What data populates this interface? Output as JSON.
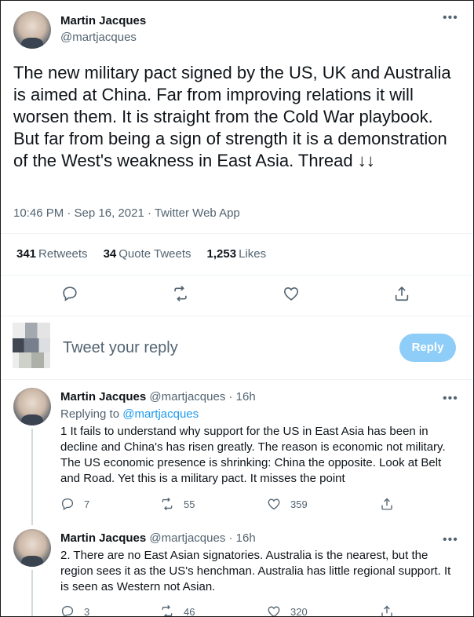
{
  "tweet": {
    "author_name": "Martin Jacques",
    "author_handle": "@martjacques",
    "text": "The new military pact signed by the US, UK and Australia is aimed at China. Far from improving relations it will worsen them. It is straight from the Cold War playbook. But far from being a sign of strength it is a demonstration of the West's weakness in East Asia. Thread ↓↓",
    "meta": "10:46 PM · Sep 16, 2021 · Twitter Web App",
    "stats": {
      "retweets_count": "341",
      "retweets_label": "Retweets",
      "quotes_count": "34",
      "quotes_label": "Quote Tweets",
      "likes_count": "1,253",
      "likes_label": "Likes"
    }
  },
  "compose": {
    "placeholder": "Tweet your reply",
    "reply_button": "Reply"
  },
  "replies": [
    {
      "author_name": "Martin Jacques",
      "author_handle_time": "@martjacques · 16h",
      "replying_to_prefix": "Replying to",
      "replying_to_handle": "@martjacques",
      "text": "1  It fails to understand why support for the US in East Asia has been in decline and China's has risen greatly. The reason is economic not military. The US economic presence is shrinking: China the opposite. Look at Belt and Road. Yet this is a military pact. It misses the point",
      "replies": "7",
      "retweets": "55",
      "likes": "359"
    },
    {
      "author_name": "Martin Jacques",
      "author_handle_time": "@martjacques · 16h",
      "text": "2. There are no East Asian signatories. Australia is the nearest, but the region sees it as the US's henchman. Australia has little regional support. It is seen as Western not Asian.",
      "replies": "3",
      "retweets": "46",
      "likes": "320"
    }
  ],
  "icons": {
    "more": "more-icon",
    "reply": "reply-icon",
    "retweet": "retweet-icon",
    "like": "heart-icon",
    "share": "share-icon"
  },
  "colors": {
    "accent": "#1d9bf0",
    "reply_button_disabled": "#8ecdf8",
    "secondary_text": "#536471"
  }
}
